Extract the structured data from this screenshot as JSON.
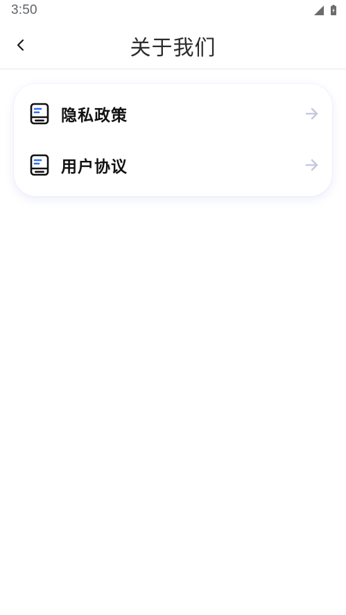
{
  "status_bar": {
    "time": "3:50",
    "icons": [
      "signal-icon",
      "battery-icon"
    ]
  },
  "header": {
    "title": "关于我们",
    "back_icon": "chevron-left-icon"
  },
  "menu": {
    "items": [
      {
        "label": "隐私政策",
        "icon": "document-icon",
        "trailing_icon": "arrow-right-icon"
      },
      {
        "label": "用户协议",
        "icon": "document-icon",
        "trailing_icon": "arrow-right-icon"
      }
    ]
  },
  "colors": {
    "icon_dark": "#111111",
    "icon_accent": "#2f6bff",
    "arrow": "#c6c9dd",
    "card_shadow": "#6e78e6"
  }
}
